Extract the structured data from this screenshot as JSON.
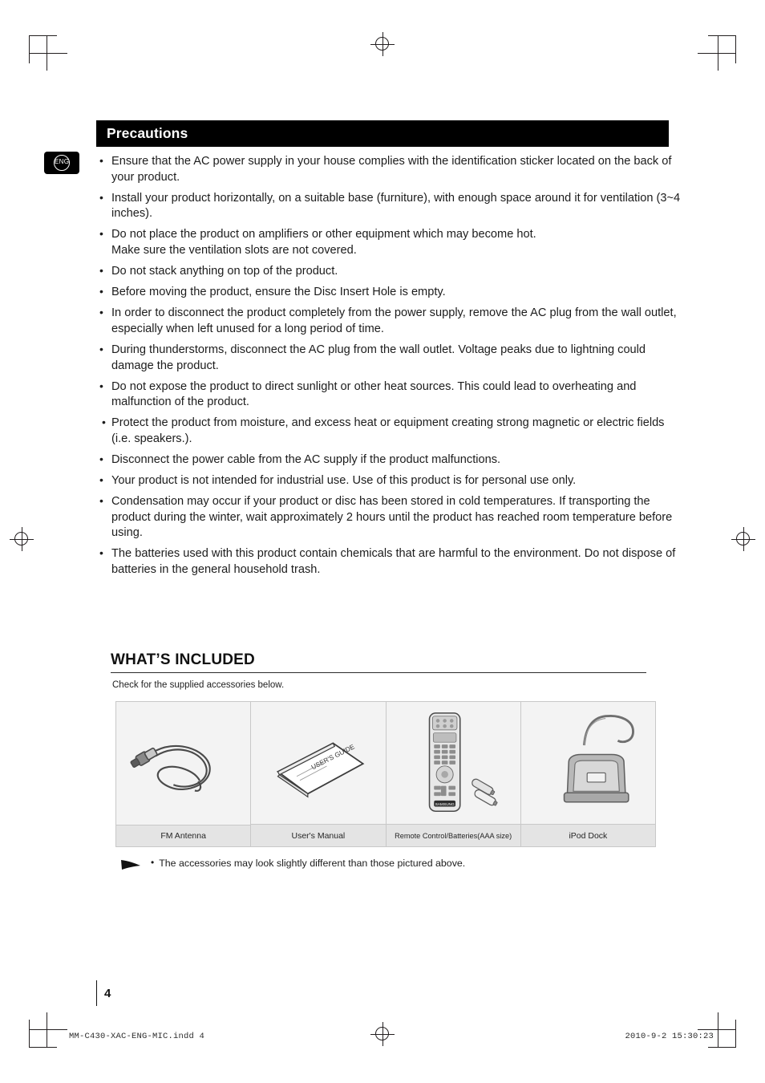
{
  "language_tab": "ENG",
  "section": {
    "title": "Precautions",
    "items": [
      "Ensure that the AC power supply in your house complies with the identification sticker located on the back of your product.",
      "Install your product horizontally, on a suitable base (furniture), with enough space around it for ventilation (3~4 inches).",
      "Do not place the product on amplifiers or other equipment which may become hot.\nMake sure the ventilation slots are not covered.",
      "Do not stack anything on top of the product.",
      "Before moving the product, ensure the Disc Insert Hole is empty.",
      "In order to disconnect the product completely from the power supply, remove the AC plug from the wall outlet, especially when left unused for a long period of time.",
      "During thunderstorms, disconnect the AC plug from the wall outlet. Voltage peaks due to lightning could damage the product.",
      "Do not expose the product to direct sunlight or other heat sources. This could lead to overheating and malfunction of the product.",
      "Protect the product from moisture, and excess heat or equipment creating strong magnetic or electric fields (i.e. speakers.).",
      "Disconnect the power cable from the AC supply if the product malfunctions.",
      "Your product is not intended for industrial use. Use of this product is for personal use only.",
      "Condensation may occur if your product or disc has been stored in cold temperatures. If transporting the product during the winter, wait approximately 2 hours until the product has reached room temperature before using.",
      "The batteries used with this product contain chemicals that are harmful to the environment. Do not dispose of batteries in the general household trash."
    ]
  },
  "whats_included": {
    "heading": "WHAT’S INCLUDED",
    "subtitle": "Check for the supplied accessories below.",
    "accessories": [
      {
        "label": "FM Antenna",
        "art": "fm-antenna"
      },
      {
        "label": "User's Manual",
        "art": "users-manual",
        "booklet_text": "USER’S GUIDE"
      },
      {
        "label": "Remote Control/Batteries(AAA size)",
        "art": "remote-control",
        "brand": "SAMSUNG"
      },
      {
        "label": "iPod Dock",
        "art": "ipod-dock"
      }
    ],
    "note": "The accessories may look slightly different than those pictured above.",
    "note_bullet": "•"
  },
  "footer": {
    "page_number": "4",
    "file_name": "MM-C430-XAC-ENG-MIC.indd   4",
    "timestamp": "2010-9-2   15:30:23"
  }
}
